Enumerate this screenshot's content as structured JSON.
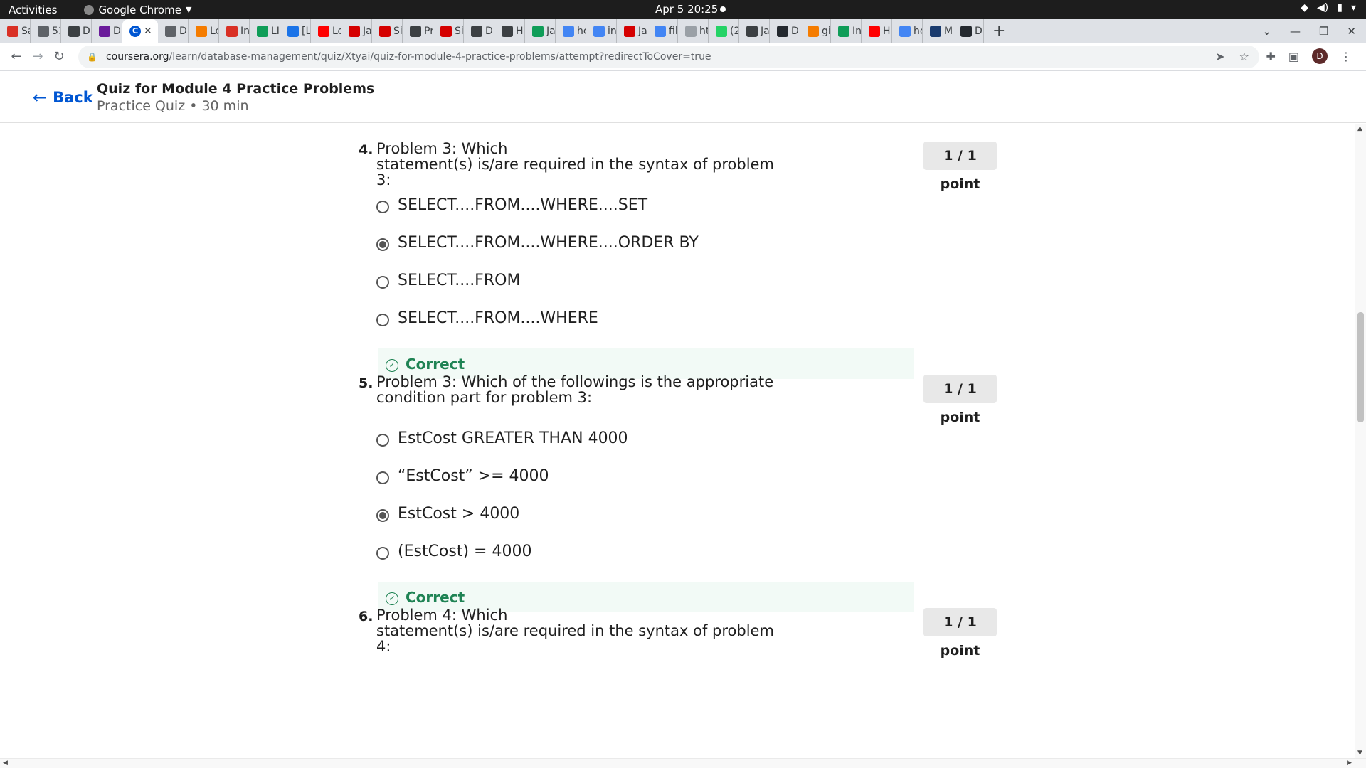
{
  "system": {
    "activities": "Activities",
    "app_name": "Google Chrome",
    "clock": "Apr 5  20:25"
  },
  "tabs": [
    {
      "label": "Sa",
      "color": "#d93025"
    },
    {
      "label": "51",
      "color": "#5f6368"
    },
    {
      "label": "Di",
      "color": "#3c4043"
    },
    {
      "label": "Di",
      "color": "#6a1b9a"
    },
    {
      "label": "",
      "color": "#0056d2",
      "active": true
    },
    {
      "label": "D",
      "color": "#5f6368"
    },
    {
      "label": "Le",
      "color": "#f57c00"
    },
    {
      "label": "In",
      "color": "#d93025"
    },
    {
      "label": "LI",
      "color": "#0f9d58"
    },
    {
      "label": "[L",
      "color": "#1a73e8"
    },
    {
      "label": "Le",
      "color": "#ff0000"
    },
    {
      "label": "Ja",
      "color": "#d50000"
    },
    {
      "label": "Si",
      "color": "#d50000"
    },
    {
      "label": "Pr",
      "color": "#3c4043"
    },
    {
      "label": "Si",
      "color": "#d50000"
    },
    {
      "label": "D",
      "color": "#3c4043"
    },
    {
      "label": "H",
      "color": "#3c4043"
    },
    {
      "label": "Ja",
      "color": "#0f9d58"
    },
    {
      "label": "hc",
      "color": "#4285f4"
    },
    {
      "label": "in",
      "color": "#4285f4"
    },
    {
      "label": "Ja",
      "color": "#d50000"
    },
    {
      "label": "fil",
      "color": "#4285f4"
    },
    {
      "label": "ht",
      "color": "#9aa0a6"
    },
    {
      "label": "(2",
      "color": "#25d366"
    },
    {
      "label": "Ja",
      "color": "#3c4043"
    },
    {
      "label": "D",
      "color": "#24292f"
    },
    {
      "label": "gi",
      "color": "#f57c00"
    },
    {
      "label": "In",
      "color": "#0f9d58"
    },
    {
      "label": "H",
      "color": "#ff0000"
    },
    {
      "label": "hc",
      "color": "#4285f4"
    },
    {
      "label": "M",
      "color": "#1a3b6e"
    },
    {
      "label": "D",
      "color": "#24292f"
    }
  ],
  "address": {
    "host": "coursera.org",
    "path": "/learn/database-management/quiz/Xtyai/quiz-for-module-4-practice-problems/attempt?redirectToCover=true"
  },
  "profile_initial": "D",
  "header": {
    "back_label": "Back",
    "title": "Quiz for Module 4 Practice Problems",
    "subtitle": "Practice Quiz • 30 min"
  },
  "questions": [
    {
      "number": "4.",
      "text": "Problem 3: Which\nstatement(s) is/are required in the syntax of problem 3:",
      "points": "1 / 1 point",
      "options": [
        {
          "label": "SELECT....FROM....WHERE....SET",
          "selected": false
        },
        {
          "label": "SELECT....FROM....WHERE....ORDER BY",
          "selected": true
        },
        {
          "label": "SELECT....FROM",
          "selected": false
        },
        {
          "label": "SELECT....FROM....WHERE",
          "selected": false
        }
      ],
      "feedback": "Correct"
    },
    {
      "number": "5.",
      "text": "Problem 3: Which of the followings is the appropriate\ncondition part for problem 3:",
      "points": "1 / 1 point",
      "options": [
        {
          "label": "EstCost GREATER THAN 4000",
          "selected": false
        },
        {
          "label": "“EstCost” >= 4000",
          "selected": false
        },
        {
          "label": "EstCost > 4000",
          "selected": true
        },
        {
          "label": "(EstCost) = 4000",
          "selected": false
        }
      ],
      "feedback": "Correct"
    },
    {
      "number": "6.",
      "text": "Problem 4: Which\nstatement(s) is/are required in the syntax of problem 4:",
      "points": "1 / 1 point",
      "options": [],
      "feedback": ""
    }
  ]
}
